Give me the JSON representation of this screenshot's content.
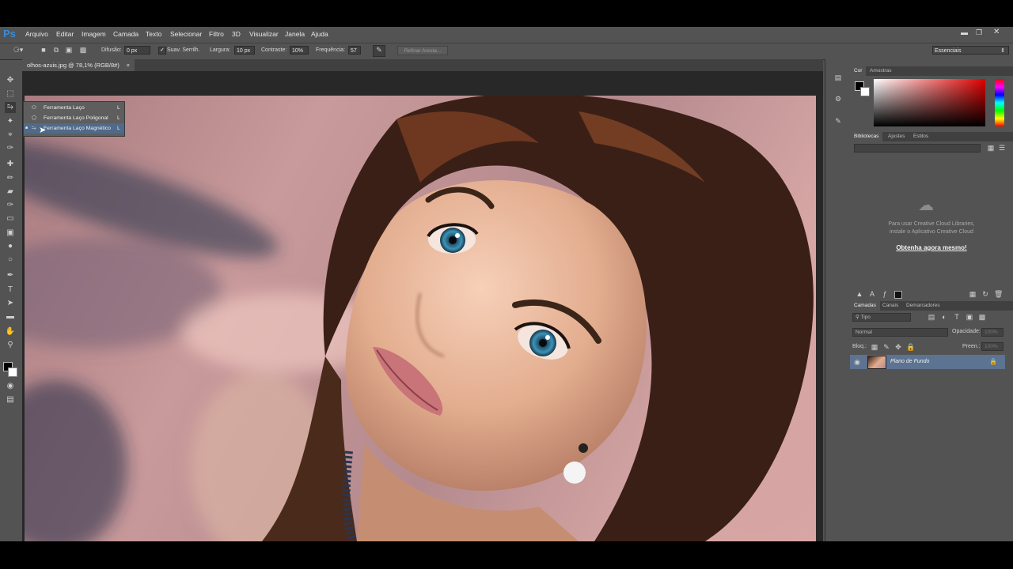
{
  "app": {
    "logo": "Ps",
    "colors": {
      "bg": "#535353",
      "accent": "#3a8bd8",
      "selection": "#5c7391"
    }
  },
  "menu": [
    "Arquivo",
    "Editar",
    "Imagem",
    "Camada",
    "Texto",
    "Selecionar",
    "Filtro",
    "3D",
    "Visualizar",
    "Janela",
    "Ajuda"
  ],
  "window_controls": [
    "minimize-icon",
    "restore-icon",
    "close-icon"
  ],
  "options_bar": {
    "difusao_label": "Difusão:",
    "difusao_value": "0 px",
    "suav_label": "Suav. Serrilh.",
    "largura_label": "Largura:",
    "largura_value": "10 px",
    "contraste_label": "Contraste:",
    "contraste_value": "10%",
    "frequencia_label": "Frequência:",
    "frequencia_value": "57",
    "refinar_label": "Refinar Aresta...",
    "workspace": "Essenciais"
  },
  "document": {
    "tab_title": "olhos-azuis.jpg @ 78,1% (RGB/8#)",
    "close": "×"
  },
  "flyout": [
    {
      "label": "Ferramenta Laço",
      "key": "L",
      "active": false
    },
    {
      "label": "Ferramenta Laço Poligonal",
      "key": "L",
      "active": false
    },
    {
      "label": "Ferramenta Laço Magnético",
      "key": "L",
      "active": true
    }
  ],
  "color_panel": {
    "tabs": [
      "Cor",
      "Amostras"
    ]
  },
  "libraries_panel": {
    "tabs": [
      "Bibliotecas",
      "Ajustes",
      "Estilos"
    ],
    "message_line1": "Para usar Creative Cloud Libraries,",
    "message_line2": "instale o Aplicativo Creative Cloud",
    "link": "Obtenha agora mesmo!"
  },
  "layers_panel": {
    "tabs": [
      "Camadas",
      "Canais",
      "Demarcadores"
    ],
    "filter": "Tipo",
    "blend": "Normal",
    "opacity_label": "Opacidade:",
    "opacity_value": "100%",
    "lock_label": "Bloq.:",
    "fill_label": "Preen.:",
    "fill_value": "100%",
    "layer_name": "Plano de Fundo"
  }
}
